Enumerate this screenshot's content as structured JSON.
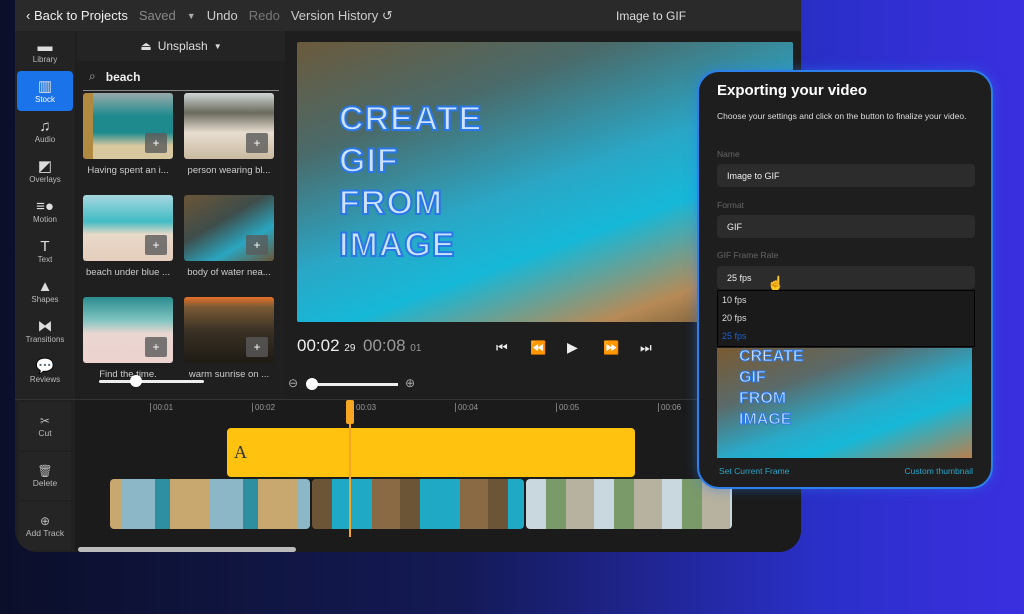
{
  "topbar": {
    "back": "Back to Projects",
    "saved": "Saved",
    "undo": "Undo",
    "redo": "Redo",
    "version_history": "Version History",
    "title": "Image to GIF"
  },
  "sidebar": {
    "items": [
      {
        "label": "Library",
        "icon": "folder-icon"
      },
      {
        "label": "Stock",
        "icon": "stock-icon",
        "active": true
      },
      {
        "label": "Audio",
        "icon": "music-icon"
      },
      {
        "label": "Overlays",
        "icon": "overlay-icon"
      },
      {
        "label": "Motion",
        "icon": "motion-icon"
      },
      {
        "label": "Text",
        "icon": "text-icon"
      },
      {
        "label": "Shapes",
        "icon": "shapes-icon"
      },
      {
        "label": "Transitions",
        "icon": "transitions-icon"
      },
      {
        "label": "Reviews",
        "icon": "comments-icon"
      }
    ]
  },
  "media": {
    "source": "Unsplash",
    "search_value": "beach",
    "items": [
      {
        "caption": "Having spent an i..."
      },
      {
        "caption": "person wearing bl..."
      },
      {
        "caption": "beach under blue ..."
      },
      {
        "caption": "body of water nea..."
      },
      {
        "caption": "Find the time."
      },
      {
        "caption": "warm sunrise on ..."
      }
    ],
    "zoom_slider": 0.35
  },
  "preview": {
    "overlay_lines": [
      "CREATE",
      "GIF",
      "FROM",
      "IMAGE"
    ]
  },
  "playback": {
    "current": "00:02",
    "current_frame": "29",
    "total": "00:08",
    "total_frame": "01",
    "zoom_slider": 0.05
  },
  "timeline": {
    "tools": [
      {
        "label": "Cut"
      },
      {
        "label": "Delete"
      },
      {
        "label": "Add Track"
      }
    ],
    "ticks": [
      "00:01",
      "00:02",
      "00:03",
      "00:04",
      "00:05",
      "00:06"
    ],
    "text_clip": "A",
    "playhead": "00:03"
  },
  "export": {
    "title": "Exporting your video",
    "description": "Choose your settings and click on the button to finalize your video.",
    "name_label": "Name",
    "name_value": "Image to GIF",
    "format_label": "Format",
    "format_value": "GIF",
    "framerate_label": "GIF Frame Rate",
    "framerate_value": "25 fps",
    "framerate_options": [
      "10 fps",
      "20 fps",
      "25 fps"
    ],
    "set_frame": "Set Current Frame",
    "custom_thumb": "Custom thumbnail"
  },
  "colors": {
    "accent": "#1a73e8",
    "clip": "#ffc20e",
    "playhead": "#f5a623"
  }
}
